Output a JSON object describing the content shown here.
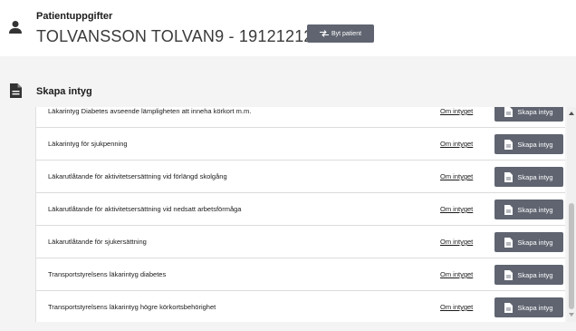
{
  "patient": {
    "label": "Patientuppgifter",
    "name": "TOLVANSSON TOLVAN9 - 19121212-1212",
    "switch_label": "Byt patient"
  },
  "section": {
    "title": "Skapa intyg"
  },
  "certificates": [
    {
      "name": "Läkarintyg Diabetes avseende lämpligheten att inneha körkort m.m.",
      "about": "Om intyget",
      "create": "Skapa intyg"
    },
    {
      "name": "Läkarintyg för sjukpenning",
      "about": "Om intyget",
      "create": "Skapa intyg"
    },
    {
      "name": "Läkarutlåtande för aktivitetsersättning vid förlängd skolgång",
      "about": "Om intyget",
      "create": "Skapa intyg"
    },
    {
      "name": "Läkarutlåtande för aktivitetsersättning vid nedsatt arbetsförmåga",
      "about": "Om intyget",
      "create": "Skapa intyg"
    },
    {
      "name": "Läkarutlåtande för sjukersättning",
      "about": "Om intyget",
      "create": "Skapa intyg"
    },
    {
      "name": "Transportstyrelsens läkarintyg diabetes",
      "about": "Om intyget",
      "create": "Skapa intyg"
    },
    {
      "name": "Transportstyrelsens läkarintyg högre körkortsbehörighet",
      "about": "Om intyget",
      "create": "Skapa intyg"
    }
  ],
  "colors": {
    "button": "#5f6470",
    "content_background": "#f4f4f4"
  }
}
